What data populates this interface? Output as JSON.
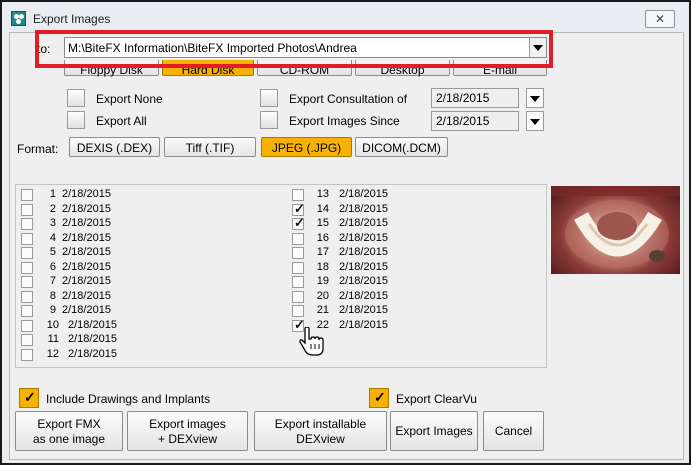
{
  "window": {
    "title": "Export Images",
    "close_symbol": "✕"
  },
  "destination": {
    "label": "to:",
    "path": "M:\\BiteFX Information\\BiteFX Imported Photos\\Andrea"
  },
  "location_tabs": [
    {
      "label": "Floppy Disk",
      "selected": false
    },
    {
      "label": "Hard Disk",
      "selected": true
    },
    {
      "label": "CD-ROM",
      "selected": false
    },
    {
      "label": "Desktop",
      "selected": false
    },
    {
      "label": "E-mail",
      "selected": false
    }
  ],
  "export_options": {
    "export_none": "Export None",
    "export_all": "Export All",
    "consultation_label": "Export Consultation of",
    "consultation_date": "2/18/2015",
    "since_label": "Export Images Since",
    "since_date": "2/18/2015"
  },
  "format": {
    "label": "Format:",
    "options": [
      {
        "label": "DEXIS (.DEX)",
        "selected": false
      },
      {
        "label": "Tiff (.TIF)",
        "selected": false
      },
      {
        "label": "JPEG (.JPG)",
        "selected": true
      },
      {
        "label": "DICOM(.DCM)",
        "selected": false
      }
    ]
  },
  "images": {
    "left": [
      {
        "num": "1",
        "date": "2/18/2015",
        "checked": false
      },
      {
        "num": "2",
        "date": "2/18/2015",
        "checked": false
      },
      {
        "num": "3",
        "date": "2/18/2015",
        "checked": false
      },
      {
        "num": "4",
        "date": "2/18/2015",
        "checked": false
      },
      {
        "num": "5",
        "date": "2/18/2015",
        "checked": false
      },
      {
        "num": "6",
        "date": "2/18/2015",
        "checked": false
      },
      {
        "num": "7",
        "date": "2/18/2015",
        "checked": false
      },
      {
        "num": "8",
        "date": "2/18/2015",
        "checked": false
      },
      {
        "num": "9",
        "date": "2/18/2015",
        "checked": false
      },
      {
        "num": "10",
        "date": "2/18/2015",
        "checked": false
      },
      {
        "num": "11",
        "date": "2/18/2015",
        "checked": false
      },
      {
        "num": "12",
        "date": "2/18/2015",
        "checked": false
      }
    ],
    "right": [
      {
        "num": "13",
        "date": "2/18/2015",
        "checked": false
      },
      {
        "num": "14",
        "date": "2/18/2015",
        "checked": true
      },
      {
        "num": "15",
        "date": "2/18/2015",
        "checked": true
      },
      {
        "num": "16",
        "date": "2/18/2015",
        "checked": false
      },
      {
        "num": "17",
        "date": "2/18/2015",
        "checked": false
      },
      {
        "num": "18",
        "date": "2/18/2015",
        "checked": false
      },
      {
        "num": "19",
        "date": "2/18/2015",
        "checked": false
      },
      {
        "num": "20",
        "date": "2/18/2015",
        "checked": false
      },
      {
        "num": "21",
        "date": "2/18/2015",
        "checked": false
      },
      {
        "num": "22",
        "date": "2/18/2015",
        "checked": true
      }
    ]
  },
  "include_drawings": {
    "label": "Include Drawings and Implants",
    "checked": true
  },
  "export_clearvu": {
    "label": "Export ClearVu",
    "checked": true
  },
  "actions": {
    "fmx_line1": "Export FMX",
    "fmx_line2": "as one image",
    "dexview_line1": "Export images",
    "dexview_line2": "+ DEXview",
    "installable_line1": "Export installable",
    "installable_line2": "DEXview",
    "export_images": "Export Images",
    "cancel": "Cancel"
  },
  "colors": {
    "selected": "#f7b100",
    "highlight": "#e11d2a"
  }
}
